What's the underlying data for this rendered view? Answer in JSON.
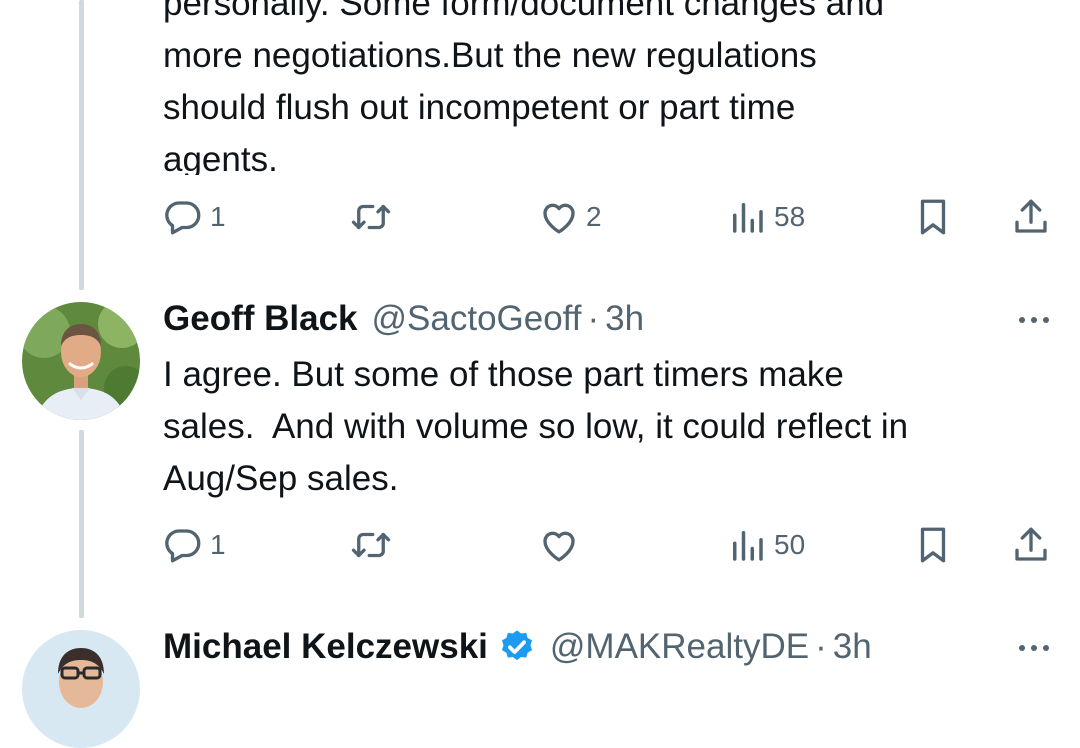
{
  "tweets": [
    {
      "text_lines": [
        "personally. Some form/document changes and",
        "more negotiations.But the new regulations",
        "should flush out incompetent or part time",
        "agents."
      ],
      "actions": {
        "reply_count": "1",
        "retweet_count": "",
        "like_count": "2",
        "views_count": "58"
      }
    },
    {
      "author_name": "Geoff Black",
      "handle": "@SactoGeoff",
      "separator": "·",
      "time": "3h",
      "text_lines": [
        "I agree. But some of those part timers make",
        "sales.  And with volume so low, it could reflect in",
        "Aug/Sep sales."
      ],
      "actions": {
        "reply_count": "1",
        "retweet_count": "",
        "like_count": "",
        "views_count": "50"
      }
    },
    {
      "author_name": "Michael Kelczewski",
      "handle": "@MAKRealtyDE",
      "separator": "·",
      "time": "3h",
      "verified": true
    }
  ],
  "colors": {
    "text": "#0f1419",
    "muted": "#536471",
    "thread_line": "#cfd9de",
    "verified_badge": "#1d9bf0"
  },
  "icons": [
    "reply-icon",
    "retweet-icon",
    "like-icon",
    "views-icon",
    "bookmark-icon",
    "share-icon",
    "more-icon",
    "verified-icon"
  ]
}
